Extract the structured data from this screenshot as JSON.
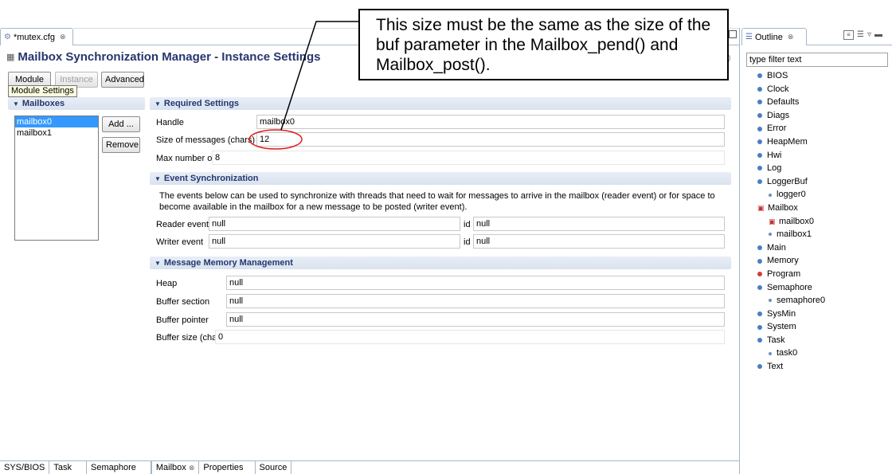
{
  "editor": {
    "tab_label": "*mutex.cfg",
    "close_glyph": "⊗",
    "icon": "config-file-icon"
  },
  "page": {
    "title": "Mailbox Synchronization Manager - Instance Settings",
    "help_glyph": "?"
  },
  "top_buttons": {
    "module": "Module",
    "instance": "Instance",
    "advanced": "Advanced"
  },
  "tooltip": "Module Settings",
  "mailboxes": {
    "header": "Mailboxes",
    "items": [
      "mailbox0",
      "mailbox1"
    ],
    "selected": "mailbox0",
    "add_label": "Add ...",
    "remove_label": "Remove"
  },
  "required": {
    "header": "Required Settings",
    "handle_label": "Handle",
    "handle_value": "mailbox0",
    "size_label": "Size of messages (chars)",
    "size_value": "12",
    "max_label": "Max number of messages",
    "max_value": "8"
  },
  "event_sync": {
    "header": "Event Synchronization",
    "description": "The events below can be used to synchronize with threads that need to wait for messages to arrive in the mailbox (reader event) or for space to become available in the mailbox for a new message to be posted (writer event).",
    "reader_label": "Reader event",
    "reader_value": "null",
    "reader_id_label": "id",
    "reader_id_value": "null",
    "writer_label": "Writer event",
    "writer_value": "null",
    "writer_id_label": "id",
    "writer_id_value": "null"
  },
  "memory": {
    "header": "Message Memory Management",
    "heap_label": "Heap",
    "heap_value": "null",
    "section_label": "Buffer section",
    "section_value": "null",
    "pointer_label": "Buffer pointer",
    "pointer_value": "null",
    "size_label": "Buffer size (chars)",
    "size_value": "0"
  },
  "callout": "This size must be the same as the size of the buf parameter in the Mailbox_pend() and Mailbox_post().",
  "bottom_tabs": [
    "SYS/BIOS",
    "Task",
    "Semaphore",
    "Mailbox",
    "Properties",
    "Source"
  ],
  "bottom_active": "Mailbox",
  "outline": {
    "tab_label": "Outline",
    "filter_placeholder": "type filter text",
    "items": [
      {
        "label": "BIOS",
        "level": 0
      },
      {
        "label": "Clock",
        "level": 0
      },
      {
        "label": "Defaults",
        "level": 0
      },
      {
        "label": "Diags",
        "level": 0
      },
      {
        "label": "Error",
        "level": 0
      },
      {
        "label": "HeapMem",
        "level": 0
      },
      {
        "label": "Hwi",
        "level": 0
      },
      {
        "label": "Log",
        "level": 0
      },
      {
        "label": "LoggerBuf",
        "level": 0
      },
      {
        "label": "logger0",
        "level": 1
      },
      {
        "label": "Mailbox",
        "level": 0
      },
      {
        "label": "mailbox0",
        "level": 1
      },
      {
        "label": "mailbox1",
        "level": 1
      },
      {
        "label": "Main",
        "level": 0
      },
      {
        "label": "Memory",
        "level": 0
      },
      {
        "label": "Program",
        "level": 0
      },
      {
        "label": "Semaphore",
        "level": 0
      },
      {
        "label": "semaphore0",
        "level": 1
      },
      {
        "label": "SysMin",
        "level": 0
      },
      {
        "label": "System",
        "level": 0
      },
      {
        "label": "Task",
        "level": 0
      },
      {
        "label": "task0",
        "level": 1
      },
      {
        "label": "Text",
        "level": 0
      }
    ]
  },
  "colors": {
    "header_text": "#26366f",
    "selection": "#3399ff",
    "annotation_red": "#e02020"
  }
}
